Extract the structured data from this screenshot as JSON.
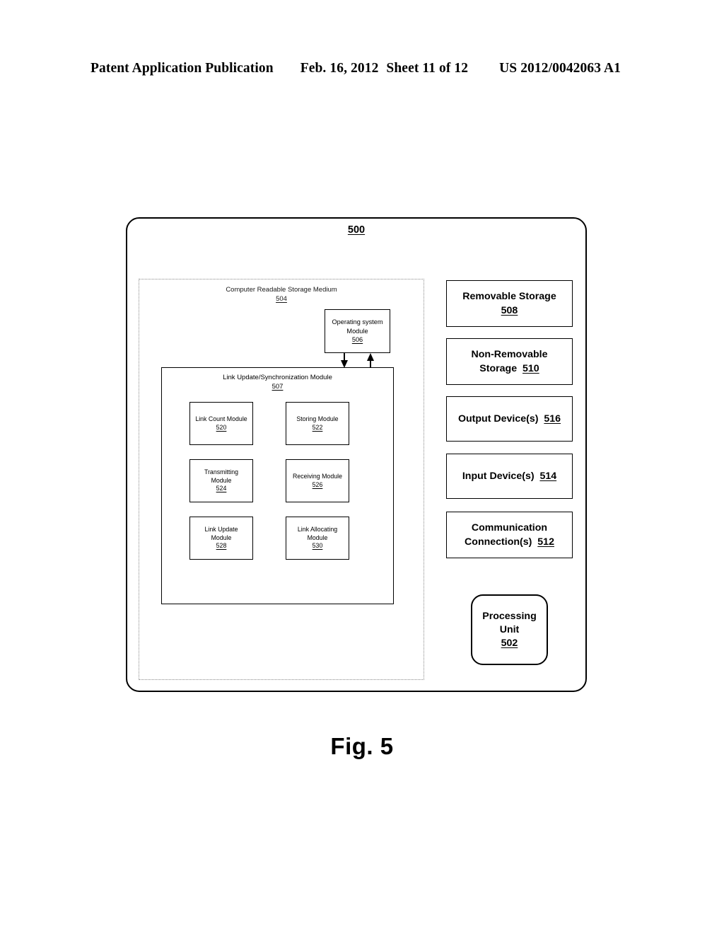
{
  "header": {
    "publication": "Patent Application Publication",
    "date": "Feb. 16, 2012",
    "sheet": "Sheet 11 of 12",
    "patent_number": "US 2012/0042063 A1"
  },
  "figure": {
    "caption": "Fig. 5"
  },
  "system": {
    "ref": "500"
  },
  "storage_medium": {
    "title": "Computer Readable Storage Medium",
    "ref": "504"
  },
  "os_module": {
    "line1": "Operating system",
    "line2": "Module",
    "ref": "506"
  },
  "link_module": {
    "title": "Link Update/Synchronization Module",
    "ref": "507",
    "modules": [
      {
        "line1": "Link Count Module",
        "line2": "",
        "ref": "520"
      },
      {
        "line1": "Storing Module",
        "line2": "",
        "ref": "522"
      },
      {
        "line1": "Transmitting",
        "line2": "Module",
        "ref": "524"
      },
      {
        "line1": "Receiving Module",
        "line2": "",
        "ref": "526"
      },
      {
        "line1": "Link Update",
        "line2": "Module",
        "ref": "528"
      },
      {
        "line1": "Link Allocating",
        "line2": "Module",
        "ref": "530"
      }
    ]
  },
  "devices": [
    {
      "line1": "Removable Storage",
      "line2": "",
      "ref": "508",
      "ref_inline": false
    },
    {
      "line1": "Non-Removable",
      "line2": "Storage",
      "ref": "510",
      "ref_inline": true
    },
    {
      "line1": "Output Device(s)",
      "line2": "",
      "ref": "516",
      "ref_inline": true
    },
    {
      "line1": "Input Device(s)",
      "line2": "",
      "ref": "514",
      "ref_inline": true
    },
    {
      "line1": "Communication",
      "line2": "Connection(s)",
      "ref": "512",
      "ref_inline": true
    }
  ],
  "processing_unit": {
    "line1": "Processing",
    "line2": "Unit",
    "ref": "502"
  },
  "colors": {
    "ink": "#000000",
    "dotted_border": "#8a8a8a",
    "background": "#ffffff"
  }
}
